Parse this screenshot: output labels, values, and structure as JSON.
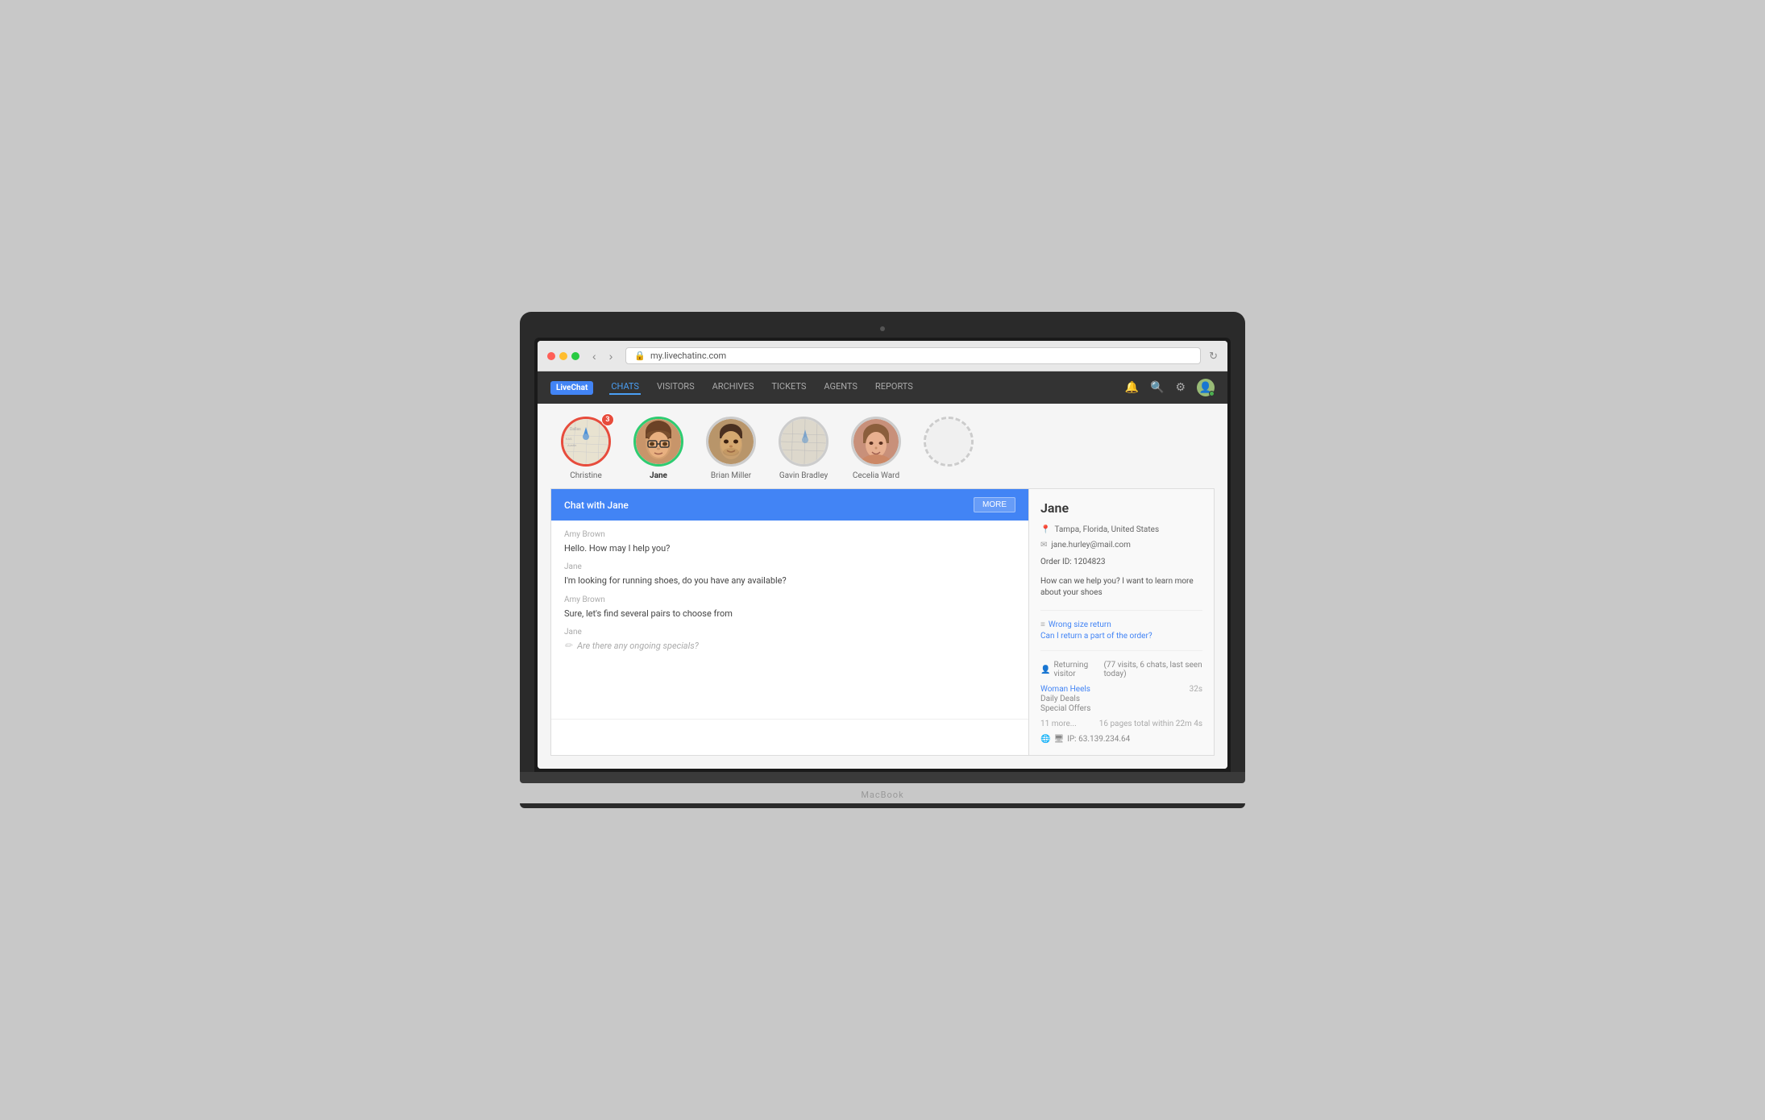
{
  "laptop": {
    "macbook_label": "MacBook"
  },
  "browser": {
    "url": "my.livechatinc.com",
    "lock_icon": "🔒"
  },
  "nav": {
    "logo": "LiveChat",
    "links": [
      {
        "label": "CHATS",
        "active": true
      },
      {
        "label": "VISITORS",
        "active": false
      },
      {
        "label": "ARCHIVES",
        "active": false
      },
      {
        "label": "TICKETS",
        "active": false
      },
      {
        "label": "AGENTS",
        "active": false
      },
      {
        "label": "REPORTS",
        "active": false
      }
    ]
  },
  "avatars": [
    {
      "name": "Christine",
      "ring": "red",
      "badge": "3",
      "type": "map"
    },
    {
      "name": "Jane",
      "ring": "green",
      "badge": null,
      "type": "face",
      "bold": true
    },
    {
      "name": "Brian Miller",
      "ring": "gray",
      "badge": null,
      "type": "face"
    },
    {
      "name": "Gavin Bradley",
      "ring": "gray",
      "badge": null,
      "type": "map2"
    },
    {
      "name": "Cecelia Ward",
      "ring": "gray",
      "badge": null,
      "type": "face2"
    },
    {
      "name": "",
      "ring": "dashed",
      "badge": null,
      "type": "empty"
    }
  ],
  "chat": {
    "title": "Chat with Jane",
    "more_btn": "MORE",
    "messages": [
      {
        "sender": "Amy Brown",
        "text": "Hello. How may I help you?",
        "typing": false
      },
      {
        "sender": "Jane",
        "text": "I'm looking for running shoes, do you have any available?",
        "typing": false
      },
      {
        "sender": "Amy Brown",
        "text": "Sure, let's find several pairs to choose from",
        "typing": false
      },
      {
        "sender": "Jane",
        "text": "Are there any ongoing specials?",
        "typing": true
      }
    ],
    "input_placeholder": ""
  },
  "sidebar": {
    "name": "Jane",
    "location": "Tampa, Florida, United States",
    "email": "jane.hurley@mail.com",
    "order_id": "Order ID: 1204823",
    "help_text": "How can we help you? I want to learn more about your shoes",
    "links": [
      "Wrong size return",
      "Can I return a part of the order?"
    ],
    "returning_visitor": "Returning visitor",
    "visits_info": "(77 visits, 6 chats, last seen today)",
    "pages": [
      {
        "name": "Woman Heels",
        "time": "32s",
        "blue": true
      },
      {
        "name": "Daily Deals",
        "time": "",
        "blue": false
      },
      {
        "name": "Special Offers",
        "time": "",
        "blue": false
      }
    ],
    "pages_more": "11 more...",
    "pages_total": "16 pages total within 22m 4s",
    "ip": "IP: 63.139.234.64"
  }
}
